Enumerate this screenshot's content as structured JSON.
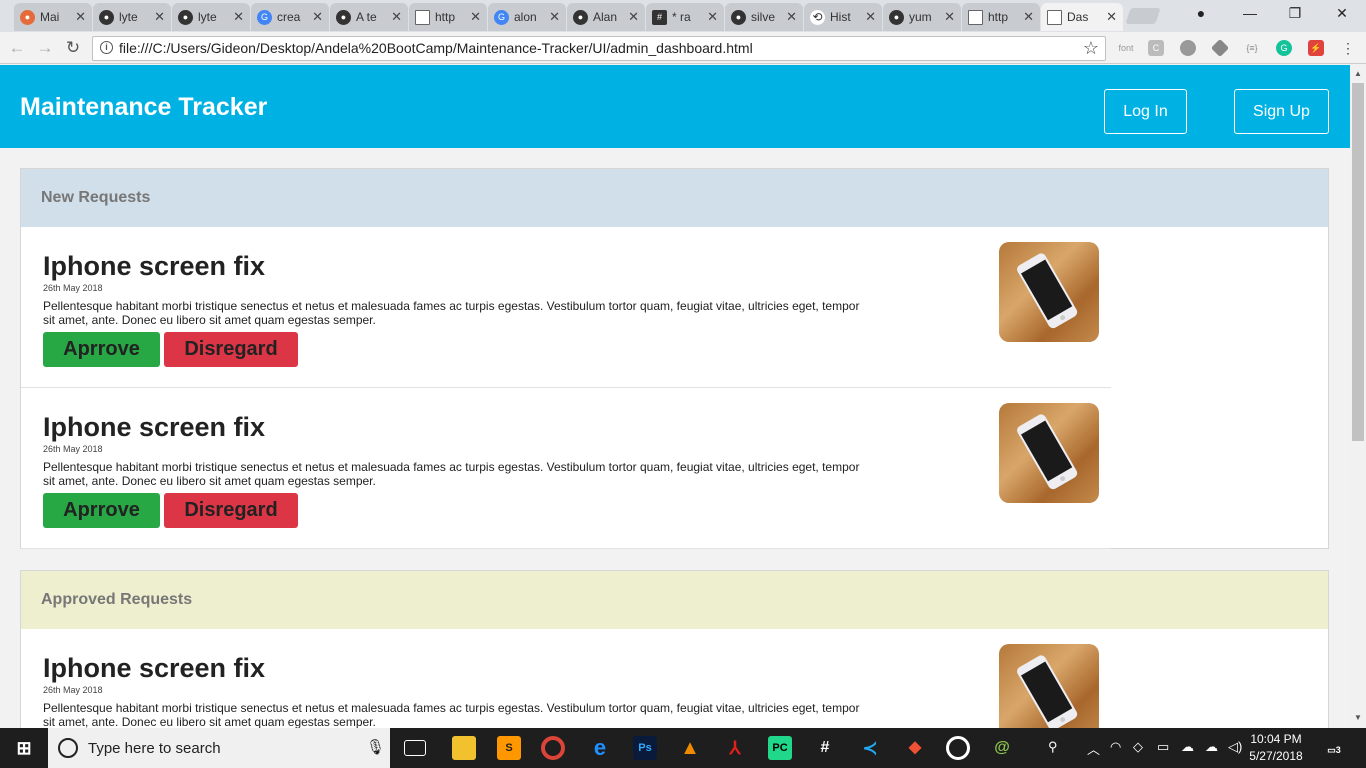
{
  "browser": {
    "tabs": [
      {
        "label": "Mai",
        "icon": "app-icon",
        "active": false
      },
      {
        "label": "lyte",
        "icon": "github-icon",
        "active": false
      },
      {
        "label": "lyte",
        "icon": "github-icon",
        "active": false
      },
      {
        "label": "crea",
        "icon": "google-icon",
        "active": false
      },
      {
        "label": "A te",
        "icon": "github-icon",
        "active": false
      },
      {
        "label": "http",
        "icon": "page-icon",
        "active": false
      },
      {
        "label": "alon",
        "icon": "google-icon",
        "active": false
      },
      {
        "label": "Alan",
        "icon": "github-icon",
        "active": false
      },
      {
        "label": "* ra",
        "icon": "hash-icon",
        "active": false
      },
      {
        "label": "silve",
        "icon": "github-icon",
        "active": false
      },
      {
        "label": "Hist",
        "icon": "history-icon",
        "active": false
      },
      {
        "label": "yum",
        "icon": "github-icon",
        "active": false
      },
      {
        "label": "http",
        "icon": "page-icon",
        "active": false
      },
      {
        "label": "Das",
        "icon": "page-icon",
        "active": true
      }
    ],
    "url": "file:///C:/Users/Gideon/Desktop/Andela%20BootCamp/Maintenance-Tracker/UI/admin_dashboard.html",
    "extensions": [
      "font",
      "C",
      "G"
    ]
  },
  "app": {
    "title": "Maintenance Tracker",
    "login_label": "Log In",
    "signup_label": "Sign Up"
  },
  "panels": [
    {
      "heading": "New Requests",
      "items": [
        {
          "title": "Iphone screen fix",
          "date": "26th May 2018",
          "description": "Pellentesque habitant morbi tristique senectus et netus et malesuada fames ac turpis egestas. Vestibulum tortor quam, feugiat vitae, ultricies eget, tempor sit amet, ante. Donec eu libero sit amet quam egestas semper.",
          "approve_label": "Aprrove",
          "disregard_label": "Disregard"
        },
        {
          "title": "Iphone screen fix",
          "date": "26th May 2018",
          "description": "Pellentesque habitant morbi tristique senectus et netus et malesuada fames ac turpis egestas. Vestibulum tortor quam, feugiat vitae, ultricies eget, tempor sit amet, ante. Donec eu libero sit amet quam egestas semper.",
          "approve_label": "Aprrove",
          "disregard_label": "Disregard"
        }
      ]
    },
    {
      "heading": "Approved Requests",
      "items": [
        {
          "title": "Iphone screen fix",
          "date": "26th May 2018",
          "description": "Pellentesque habitant morbi tristique senectus et netus et malesuada fames ac turpis egestas. Vestibulum tortor quam, feugiat vitae, ultricies eget, tempor sit amet, ante. Donec eu libero sit amet quam egestas semper."
        }
      ]
    }
  ],
  "taskbar": {
    "search_placeholder": "Type here to search",
    "time": "10:04 PM",
    "date": "5/27/2018",
    "notification_count": "3"
  },
  "colors": {
    "header": "#00b2e3",
    "new_requests_head": "#d0dfea",
    "approved_requests_head": "#eeefcf",
    "approve": "#28a745",
    "disregard": "#dc3545"
  }
}
